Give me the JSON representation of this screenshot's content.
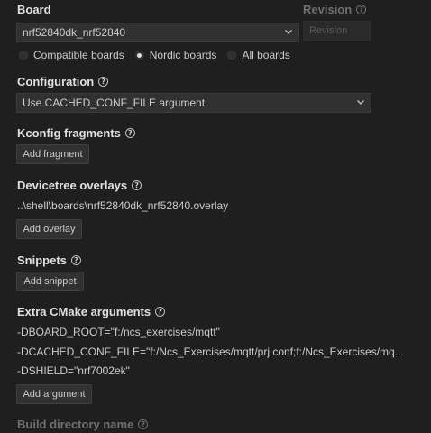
{
  "board": {
    "label": "Board",
    "selected": "nrf52840dk_nrf52840",
    "radio_options": [
      {
        "label": "Compatible boards",
        "checked": false
      },
      {
        "label": "Nordic boards",
        "checked": true
      },
      {
        "label": "All boards",
        "checked": false
      }
    ]
  },
  "revision": {
    "label": "Revision",
    "placeholder": "Revision"
  },
  "configuration": {
    "label": "Configuration",
    "selected": "Use CACHED_CONF_FILE argument"
  },
  "kconfig": {
    "label": "Kconfig fragments",
    "button": "Add fragment"
  },
  "devicetree": {
    "label": "Devicetree overlays",
    "value": "..\\shell\\boards\\nrf52840dk_nrf52840.overlay",
    "button": "Add overlay"
  },
  "snippets": {
    "label": "Snippets",
    "button": "Add snippet"
  },
  "cmake": {
    "label": "Extra CMake arguments",
    "args": [
      "-DBOARD_ROOT=\"f:/ncs_exercises/mqtt\"",
      "-DCACHED_CONF_FILE=\"f:/Ncs_Exercises/mqtt/prj.conf;f:/Ncs_Exercises/mq...",
      "-DSHIELD=\"nrf7002ek\""
    ],
    "button": "Add argument"
  },
  "build_dir": {
    "label": "Build directory name"
  },
  "icons": {
    "info": "info-icon",
    "chevron": "chevron-down-icon"
  }
}
